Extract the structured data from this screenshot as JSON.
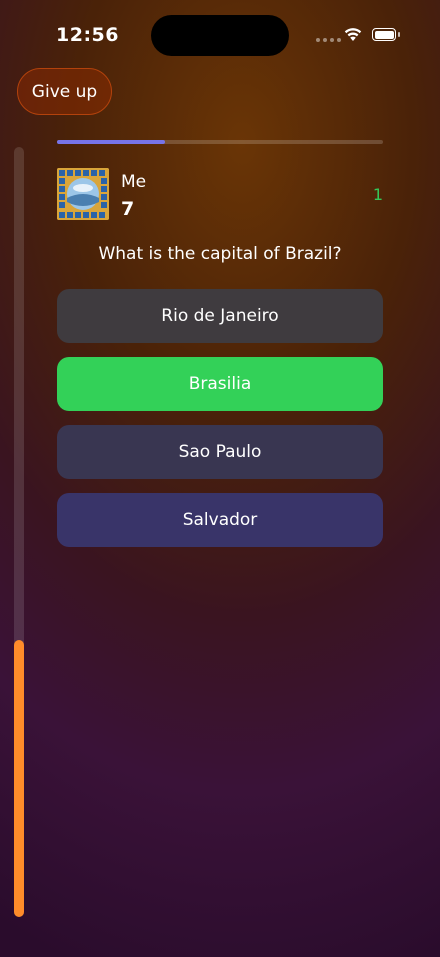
{
  "status_bar": {
    "time": "12:56",
    "battery_level": 1.0
  },
  "header": {
    "give_up_label": "Give up"
  },
  "quiz": {
    "progress": 0.33,
    "time_remaining_fraction": 0.36,
    "player": {
      "name": "Me",
      "score": "7",
      "avatar_icon": "decorated-tile-avatar"
    },
    "counter": "1",
    "question": "What is the capital of Brazil?",
    "answers": [
      {
        "label": "Rio de Janeiro",
        "state": "neutral",
        "color": "#3f3b3f"
      },
      {
        "label": "Brasilia",
        "state": "correct",
        "color": "#33d158"
      },
      {
        "label": "Sao Paulo",
        "state": "neutral",
        "color": "#393651"
      },
      {
        "label": "Salvador",
        "state": "neutral",
        "color": "#393469"
      }
    ]
  },
  "colors": {
    "accent_orange": "#ff8c2a",
    "progress": "#7774e8",
    "correct_green": "#33d158",
    "give_up_border": "#b3420c"
  }
}
